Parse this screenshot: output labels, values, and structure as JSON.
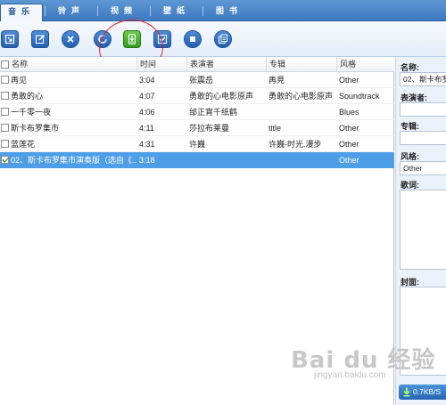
{
  "tabs": [
    {
      "label": "音乐",
      "active": true
    },
    {
      "label": "铃声",
      "active": false
    },
    {
      "label": "视频",
      "active": false
    },
    {
      "label": "壁纸",
      "active": false
    },
    {
      "label": "图书",
      "active": false
    }
  ],
  "toolbar": {
    "buttons": [
      {
        "icon": "import-icon"
      },
      {
        "icon": "edit-icon"
      },
      {
        "icon": "delete-icon"
      },
      {
        "icon": "refresh-icon"
      },
      {
        "icon": "download-to-device-icon",
        "highlighted": true
      },
      {
        "icon": "select-all-icon"
      },
      {
        "icon": "stop-icon"
      },
      {
        "icon": "copy-icon"
      }
    ]
  },
  "columns": [
    "名称",
    "时间",
    "表演者",
    "专辑",
    "风格"
  ],
  "rows": [
    {
      "checked": false,
      "name": "再见",
      "time": "3:04",
      "artist": "张震岳",
      "album": "再見",
      "genre": "Other"
    },
    {
      "checked": false,
      "name": "勇敢的心",
      "time": "4:07",
      "artist": "勇敢的心电影原声",
      "album": "勇敢的心电影原声",
      "genre": "Soundtrack"
    },
    {
      "checked": false,
      "name": "一千零一夜",
      "time": "4:06",
      "artist": "邰正宵千纸鹤",
      "album": "",
      "genre": "Blues"
    },
    {
      "checked": false,
      "name": "斯卡布罗集市",
      "time": "4:11",
      "artist": "莎拉布莱曼",
      "album": "title",
      "genre": "Other"
    },
    {
      "checked": false,
      "name": "蓝莲花",
      "time": "4:31",
      "artist": "许巍",
      "album": "许巍-时光.漫步",
      "genre": "Other"
    },
    {
      "checked": true,
      "name": "02、斯卡布罗集市演奏版（选自《...",
      "time": "3:18",
      "artist": "",
      "album": "",
      "genre": "Other",
      "selected": true
    }
  ],
  "details": {
    "name_label": "名称:",
    "name_value": "02、斯卡布罗",
    "artist_label": "表演者:",
    "album_label": "专辑:",
    "genre_label": "风格:",
    "genre_value": "Other",
    "lyrics_label": "歌词:",
    "cover_label": "封面:"
  },
  "status": {
    "speed": "0.7KB/S"
  },
  "watermark": {
    "main": "Bai du 经验",
    "sub": "jingyan.baidu.com"
  },
  "colors": {
    "accent": "#3e78bf",
    "selection": "#4d9ee6",
    "annotation": "#d8232a"
  }
}
